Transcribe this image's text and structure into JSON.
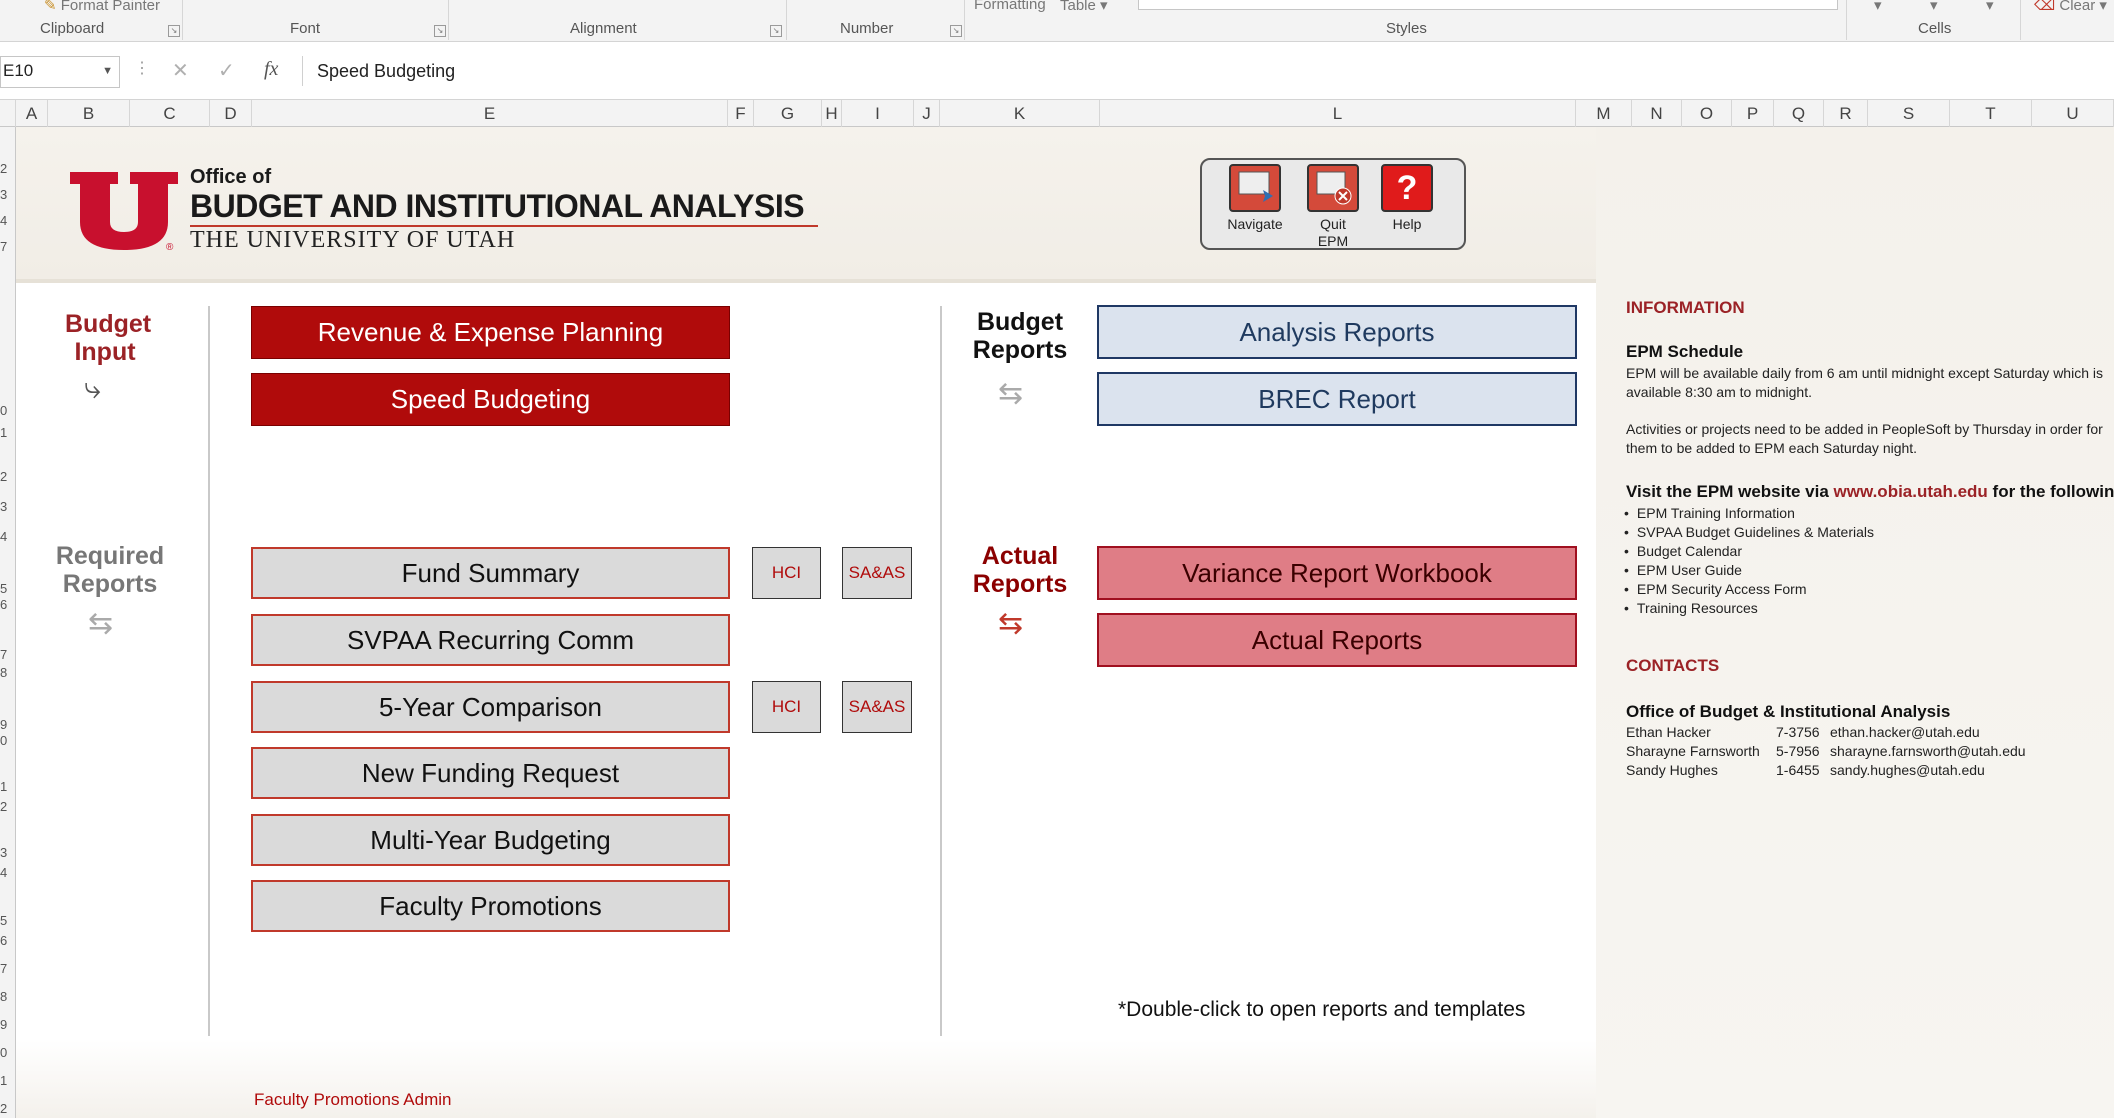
{
  "ribbon": {
    "format_painter": "Format Painter",
    "formatting": "Formatting",
    "table": "Table",
    "clear": "Clear",
    "groups": [
      "Clipboard",
      "Font",
      "Alignment",
      "Number",
      "Styles",
      "Cells"
    ]
  },
  "formula_bar": {
    "name_box": "E10",
    "fx_label": "fx",
    "value": "Speed Budgeting"
  },
  "columns": [
    "A",
    "B",
    "C",
    "D",
    "E",
    "F",
    "G",
    "H",
    "I",
    "J",
    "K",
    "L",
    "M",
    "N",
    "O",
    "P",
    "Q",
    "R",
    "S",
    "T",
    "U"
  ],
  "rows": [
    "2",
    "3",
    "4",
    "7",
    "0",
    "1",
    "2",
    "3",
    "4",
    "5",
    "6",
    "7",
    "8",
    "9",
    "0",
    "1",
    "2",
    "3",
    "4",
    "5",
    "6",
    "7",
    "8",
    "9",
    "0",
    "1",
    "2"
  ],
  "header": {
    "office_of": "Office of",
    "office_name": "BUDGET AND INSTITUTIONAL ANALYSIS",
    "university": "THE UNIVERSITY OF UTAH"
  },
  "toolbar": {
    "navigate": "Navigate",
    "quit": "Quit EPM",
    "help": "Help"
  },
  "sections": {
    "budget_input": "Budget Input",
    "required_reports": "Required Reports",
    "budget_reports": "Budget Reports",
    "actual_reports": "Actual Reports"
  },
  "buttons": {
    "revenue_expense": "Revenue & Expense Planning",
    "speed_budgeting": "Speed Budgeting",
    "fund_summary": "Fund Summary",
    "svpaa": "SVPAA Recurring Comm",
    "five_year": "5-Year Comparison",
    "new_funding": "New Funding Request",
    "multi_year": "Multi-Year Budgeting",
    "faculty_promotions": "Faculty Promotions",
    "hci": "HCI",
    "saas": "SA&AS",
    "analysis_reports": "Analysis Reports",
    "brec_report": "BREC Report",
    "variance_workbook": "Variance Report Workbook",
    "actual_reports": "Actual Reports"
  },
  "info": {
    "heading": "INFORMATION",
    "schedule_title": "EPM Schedule",
    "schedule_line1": "EPM will be available daily from 6 am until midnight except Saturday which is",
    "schedule_line2": "available 8:30 am to midnight.",
    "activities_line1": "Activities or projects need to be added in PeopleSoft by Thursday in order for",
    "activities_line2": "them to be added to EPM each Saturday night.",
    "visit_prefix": "Visit the EPM website via ",
    "visit_link": "www.obia.utah.edu",
    "visit_suffix": " for the following",
    "list": [
      "EPM Training Information",
      "SVPAA Budget Guidelines & Materials",
      "Budget Calendar",
      "EPM User Guide",
      "EPM Security Access Form",
      "Training Resources"
    ],
    "contacts_heading": "CONTACTS",
    "contacts_title": "Office of Budget & Institutional Analysis",
    "contacts": [
      {
        "name": "Ethan Hacker",
        "phone": "7-3756",
        "email": "ethan.hacker@utah.edu"
      },
      {
        "name": "Sharayne Farnsworth",
        "phone": "5-7956",
        "email": "sharayne.farnsworth@utah.edu"
      },
      {
        "name": "Sandy Hughes",
        "phone": "1-6455",
        "email": "sandy.hughes@utah.edu"
      }
    ]
  },
  "footnote": "*Double-click to open reports and templates",
  "admin_link": "Faculty Promotions Admin",
  "colors": {
    "utah_red": "#b00b0b",
    "blue_button": "#dbe3ee",
    "pink_button": "#df7d86"
  }
}
